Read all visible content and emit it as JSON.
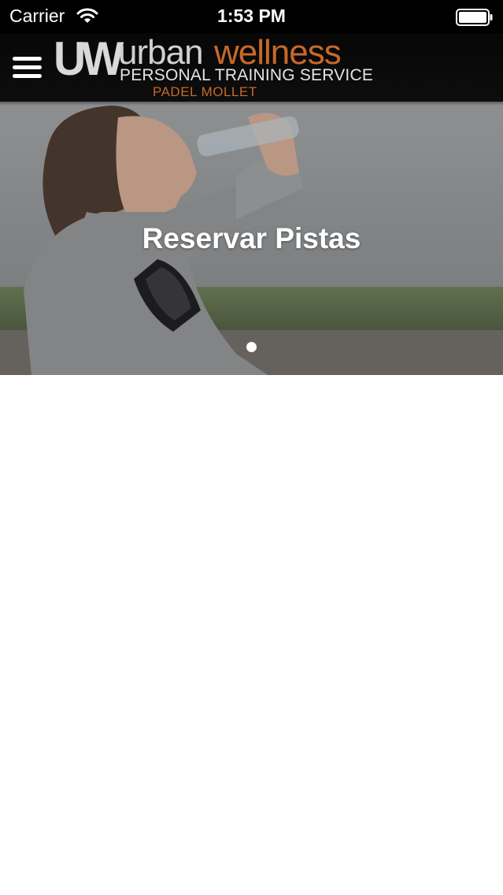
{
  "status_bar": {
    "carrier": "Carrier",
    "time": "1:53 PM",
    "wifi_icon": "wifi-icon",
    "battery_icon": "battery-icon"
  },
  "nav_bar": {
    "menu_icon": "hamburger-menu-icon",
    "logo": {
      "monogram": "UW",
      "brand_part1": "urban",
      "brand_part2": "wellness",
      "tagline": "PERSONAL TRAINING SERVICE",
      "location": "PADEL MOLLET"
    }
  },
  "hero": {
    "title": "Reservar Pistas",
    "page_indicator": {
      "current": 1,
      "total": 1
    }
  },
  "colors": {
    "brand_orange": "#c8692a",
    "nav_background": "#0a0a0a",
    "status_background": "#000000"
  }
}
